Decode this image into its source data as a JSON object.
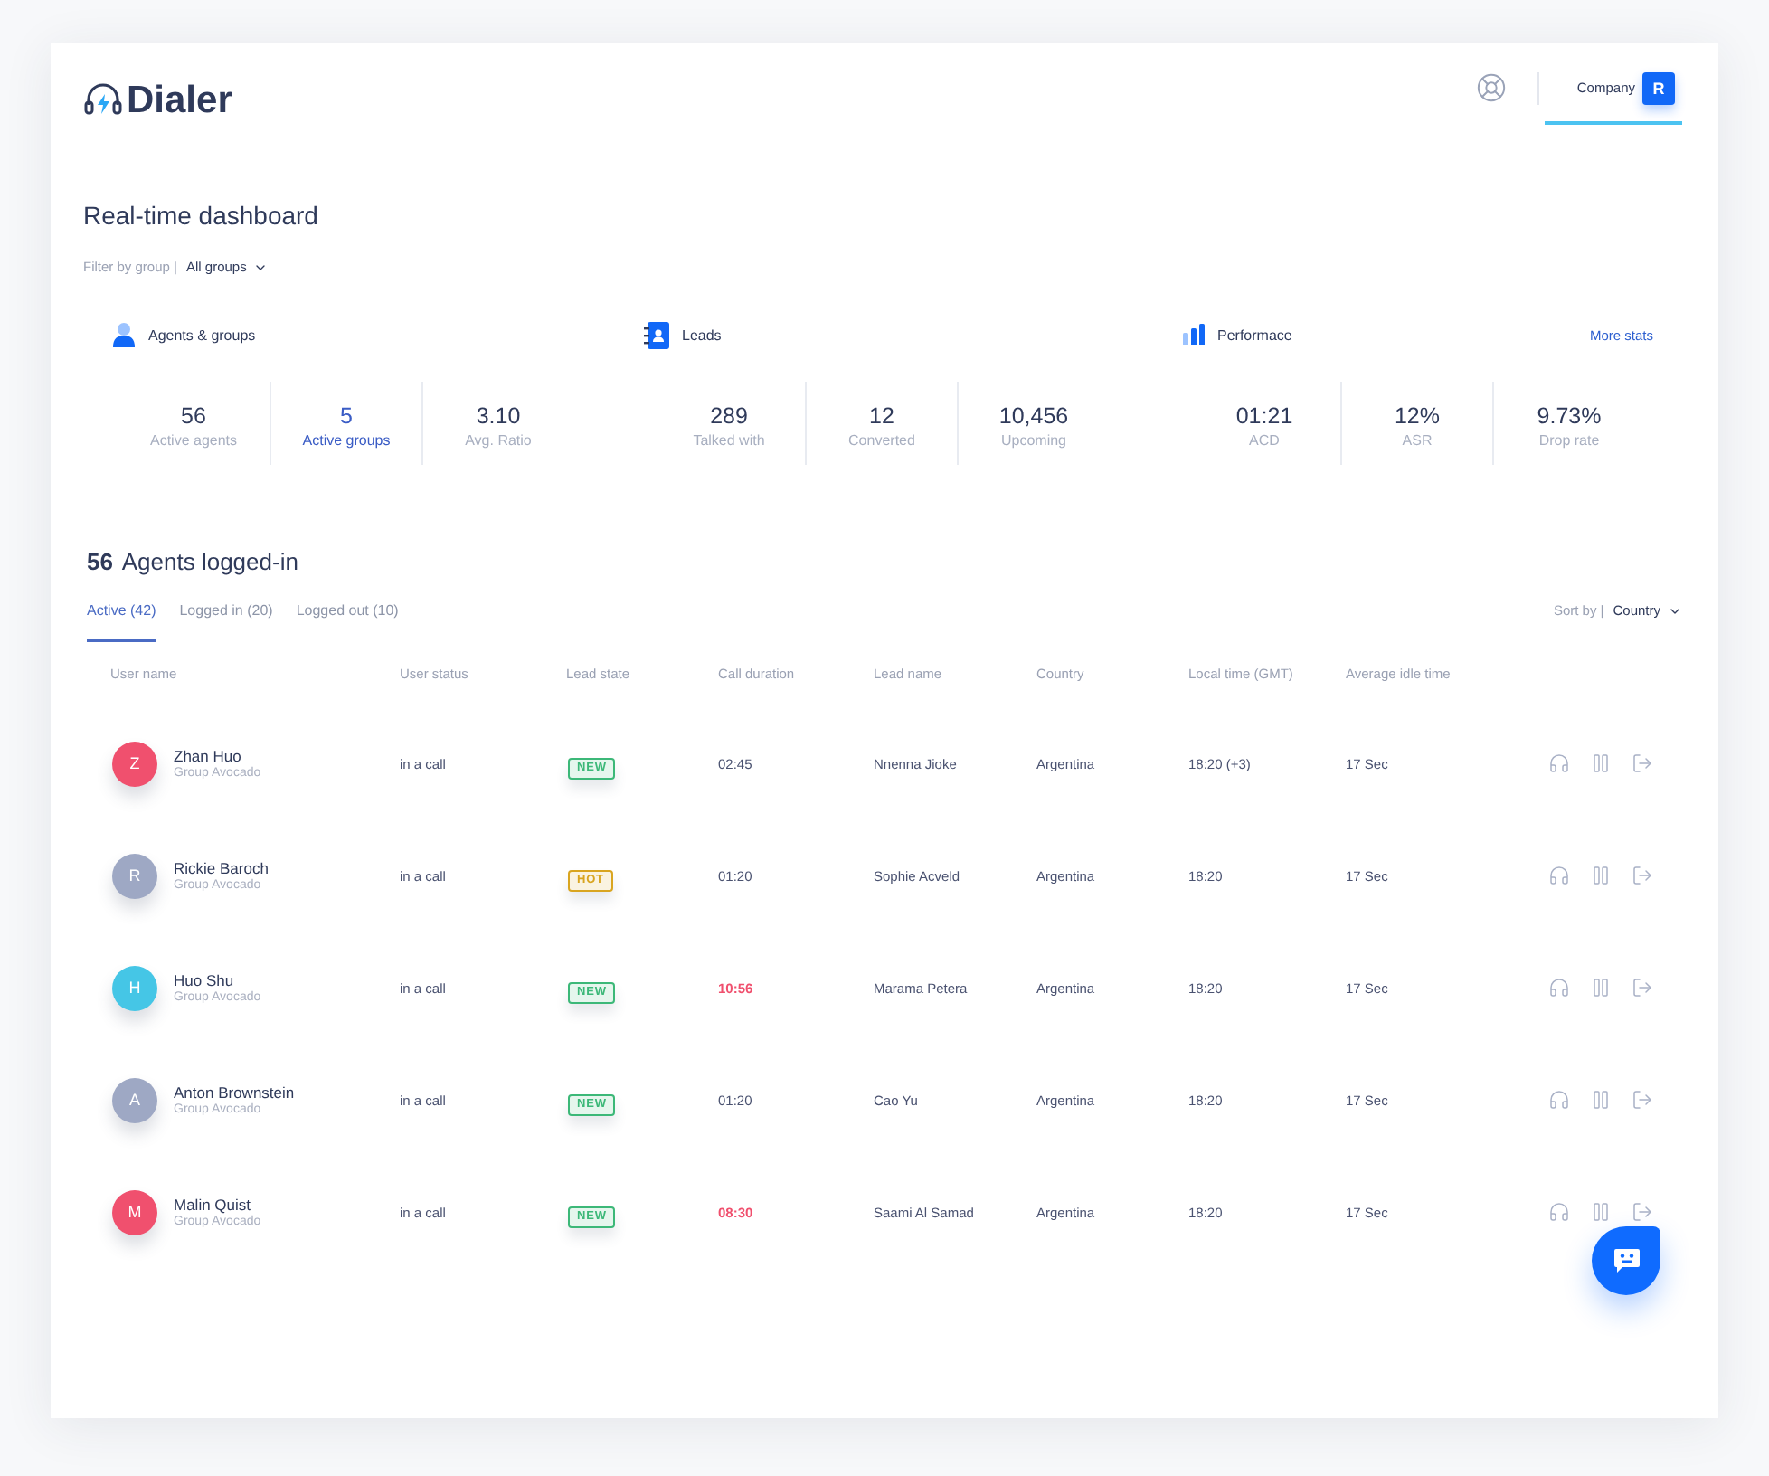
{
  "header": {
    "logo": "Dialer",
    "company": "Company",
    "company_initial": "R"
  },
  "dashboard": {
    "title": "Real-time dashboard",
    "filter_label": "Filter by group |",
    "filter_value": "All groups",
    "more_stats": "More stats",
    "stat_groups": [
      {
        "kind": "agents",
        "title": "Agents & groups",
        "stats": [
          {
            "value": "56",
            "label": "Active agents",
            "selected": false
          },
          {
            "value": "5",
            "label": "Active groups",
            "selected": true
          },
          {
            "value": "3.10",
            "label": "Avg. Ratio",
            "selected": false
          }
        ]
      },
      {
        "kind": "leads",
        "title": "Leads",
        "stats": [
          {
            "value": "289",
            "label": "Talked with",
            "selected": false
          },
          {
            "value": "12",
            "label": "Converted",
            "selected": false
          },
          {
            "value": "10,456",
            "label": "Upcoming",
            "selected": false
          }
        ]
      },
      {
        "kind": "performance",
        "title": "Performace",
        "stats": [
          {
            "value": "01:21",
            "label": "ACD",
            "selected": false
          },
          {
            "value": "12%",
            "label": "ASR",
            "selected": false
          },
          {
            "value": "9.73%",
            "label": "Drop rate",
            "selected": false
          }
        ]
      }
    ]
  },
  "agents": {
    "title": "**56** Agents logged-in",
    "tabs": [
      {
        "label": "Active (42)",
        "selected": true
      },
      {
        "label": "Logged in (20)",
        "selected": false
      },
      {
        "label": "Logged out (10)",
        "selected": false
      }
    ],
    "sort_label": "Sort by |",
    "sort_value": "Country"
  },
  "table": {
    "columns": [
      "User name",
      "User status",
      "Lead state",
      "Call duration",
      "Lead name",
      "Country",
      "Local time (GMT)",
      "Average idle time"
    ],
    "rows": [
      {
        "initial": "Z",
        "color": "#f0506e",
        "name": "Zhan Huo",
        "group": "Group Avocado",
        "status": "in a call",
        "lead_state": {
          "label": "NEW",
          "color": "#3cb878"
        },
        "duration": "02:45",
        "alert": false,
        "lead_name": "Nnenna Jioke",
        "country": "Argentina",
        "local_time": "18:20 (+3)",
        "idle": "17 Sec"
      },
      {
        "initial": "R",
        "color": "#9ea8c4",
        "name": "Rickie Baroch",
        "group": "Group Avocado",
        "status": "in a call",
        "lead_state": {
          "label": "HOT",
          "color": "#d9a520"
        },
        "duration": "01:20",
        "alert": false,
        "lead_name": "Sophie Acveld",
        "country": "Argentina",
        "local_time": "18:20",
        "idle": "17 Sec"
      },
      {
        "initial": "H",
        "color": "#45c6e6",
        "name": "Huo Shu",
        "group": "Group Avocado",
        "status": "in a call",
        "lead_state": {
          "label": "NEW",
          "color": "#3cb878"
        },
        "duration": "10:56",
        "alert": true,
        "lead_name": "Marama Petera",
        "country": "Argentina",
        "local_time": "18:20",
        "idle": "17 Sec"
      },
      {
        "initial": "A",
        "color": "#9ea8c4",
        "name": "Anton Brownstein",
        "group": "Group Avocado",
        "status": "in a call",
        "lead_state": {
          "label": "NEW",
          "color": "#3cb878"
        },
        "duration": "01:20",
        "alert": false,
        "lead_name": "Cao Yu",
        "country": "Argentina",
        "local_time": "18:20",
        "idle": "17 Sec"
      },
      {
        "initial": "M",
        "color": "#f0506e",
        "name": "Malin Quist",
        "group": "Group Avocado",
        "status": "in a call",
        "lead_state": {
          "label": "NEW",
          "color": "#3cb878"
        },
        "duration": "08:30",
        "alert": true,
        "lead_name": "Saami Al Samad",
        "country": "Argentina",
        "local_time": "18:20",
        "idle": "17 Sec"
      }
    ]
  }
}
